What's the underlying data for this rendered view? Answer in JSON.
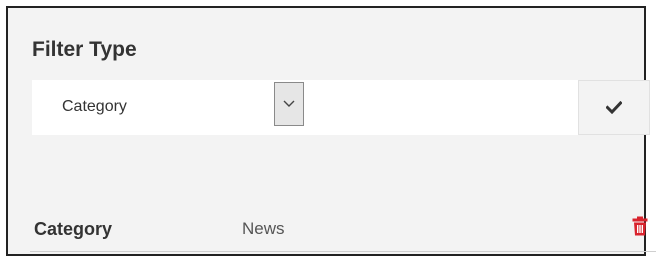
{
  "filter_panel": {
    "title": "Filter Type",
    "type_select": {
      "selected": "Category"
    },
    "value_input": {
      "value": "",
      "placeholder": ""
    },
    "apply_icon": "checkmark-icon"
  },
  "active_filters": [
    {
      "label": "Category",
      "value": "News",
      "delete_icon": "trash-icon",
      "delete_color": "#d9232d"
    }
  ]
}
